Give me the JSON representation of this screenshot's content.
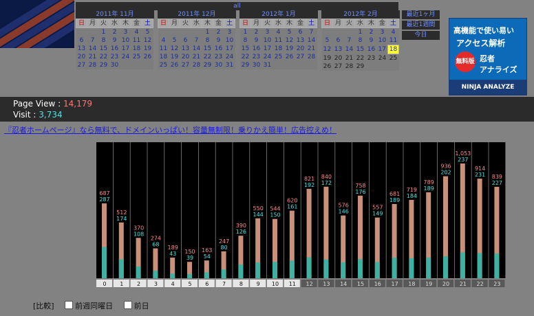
{
  "header": {
    "all_label": "all",
    "quick_links": [
      "最近1ヶ月",
      "最近1週間",
      "今日"
    ]
  },
  "calendars": [
    {
      "title": "2011年 11月",
      "offset": 2,
      "days": 30,
      "today": null
    },
    {
      "title": "2011年 12月",
      "offset": 4,
      "days": 31,
      "today": null
    },
    {
      "title": "2012年 1月",
      "offset": 0,
      "days": 31,
      "today": null
    },
    {
      "title": "2012年 2月",
      "offset": 3,
      "days": 29,
      "today": 18
    }
  ],
  "weekdays": [
    "日",
    "月",
    "火",
    "水",
    "木",
    "金",
    "土"
  ],
  "ad": {
    "line1": "高機能で使い易い",
    "line2": "アクセス解析",
    "badge": "無料版",
    "name1": "忍者",
    "name2": "アナライズ",
    "footer": "NINJA ANALYZE"
  },
  "stats": {
    "pageview_label": "Page View : ",
    "pageview_value": "14,179",
    "visit_label": "Visit : ",
    "visit_value": "3,734"
  },
  "ad_link": "『忍者ホームページ』なら無料で、ドメインいっぱい！容量無制限！乗りかえ簡単！広告控えめ！",
  "chart_data": {
    "type": "bar",
    "categories": [
      "0",
      "1",
      "2",
      "3",
      "4",
      "5",
      "6",
      "7",
      "8",
      "9",
      "10",
      "11",
      "12",
      "13",
      "14",
      "15",
      "16",
      "17",
      "18",
      "19",
      "20",
      "21",
      "22",
      "23"
    ],
    "series": [
      {
        "values": [
          687,
          512,
          370,
          274,
          189,
          150,
          163,
          247,
          390,
          550,
          544,
          620,
          821,
          840,
          576,
          758,
          557,
          681,
          719,
          789,
          936,
          1053,
          914,
          839
        ]
      },
      {
        "values": [
          287,
          174,
          108,
          68,
          43,
          39,
          54,
          80,
          126,
          144,
          150,
          161,
          192,
          172,
          146,
          176,
          149,
          189,
          184,
          189,
          202,
          237,
          231,
          227
        ]
      }
    ],
    "labels_pv": [
      "687",
      "512",
      "370",
      "274",
      "189",
      "150",
      "163",
      "247",
      "390",
      "550",
      "544",
      "620",
      "821",
      "840",
      "576",
      "758",
      "557",
      "681",
      "719",
      "789",
      "936",
      "1,053",
      "914",
      "839"
    ],
    "labels_visit": [
      "287",
      "174",
      "108",
      "68",
      "43",
      "39",
      "54",
      "80",
      "126",
      "144",
      "150",
      "161",
      "192",
      "172",
      "146",
      "176",
      "149",
      "189",
      "184",
      "189",
      "202",
      "237",
      "231",
      "227"
    ],
    "colors": {
      "pageview": "#ff8a8a",
      "visit": "#44e6e6",
      "bar_pv": "#c89078",
      "bar_visit": "#3fb1a3"
    }
  },
  "compare": {
    "label": "[比較]",
    "option1": "前週同曜日",
    "option2": "前日"
  }
}
